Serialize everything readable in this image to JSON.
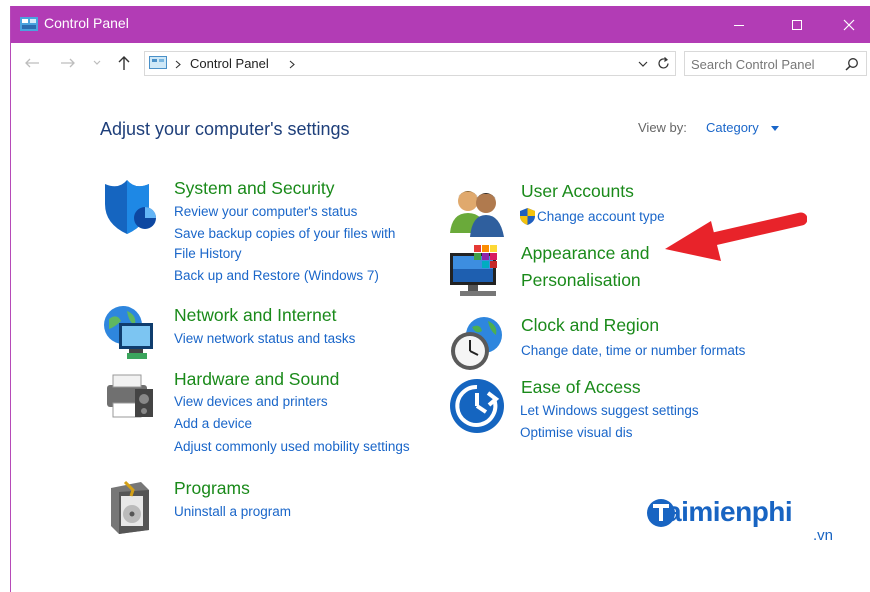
{
  "window": {
    "title": "Control Panel",
    "accent_color": "#b23cb5"
  },
  "address": {
    "breadcrumb": "Control Panel",
    "search_placeholder": "Search Control Panel"
  },
  "main": {
    "heading": "Adjust your computer's settings",
    "view_by_label": "View by:",
    "view_by_value": "Category"
  },
  "categories": [
    {
      "title": "System and Security",
      "icon": "shield-icon",
      "links": [
        "Review your computer's status",
        "Save backup copies of your files with",
        "File History",
        "Back up and Restore (Windows 7)"
      ]
    },
    {
      "title": "Network and Internet",
      "icon": "network-globe-icon",
      "links": [
        "View network status and tasks"
      ]
    },
    {
      "title": "Hardware and Sound",
      "icon": "printer-icon",
      "links": [
        "View devices and printers",
        "Add a device",
        "Adjust commonly used mobility settings"
      ]
    },
    {
      "title": "Programs",
      "icon": "programs-box-icon",
      "links": [
        "Uninstall a program"
      ]
    },
    {
      "title": "User Accounts",
      "icon": "users-icon",
      "links": [
        "Change account type"
      ]
    },
    {
      "title_line1": "Appearance and",
      "title_line2": "Personalisation",
      "icon": "display-color-icon"
    },
    {
      "title": "Clock and Region",
      "icon": "clock-globe-icon",
      "links": [
        "Change date, time or number formats"
      ]
    },
    {
      "title": "Ease of Access",
      "icon": "ease-of-access-icon",
      "links": [
        "Let Windows suggest settings",
        "Optimise visual dis"
      ]
    }
  ],
  "watermark": {
    "text": "aimienphi",
    "suffix": ".vn"
  },
  "colors": {
    "category_title": "#1a8a1a",
    "link": "#1a66c9",
    "heading": "#1e3f7a",
    "arrow": "#e8232a"
  }
}
